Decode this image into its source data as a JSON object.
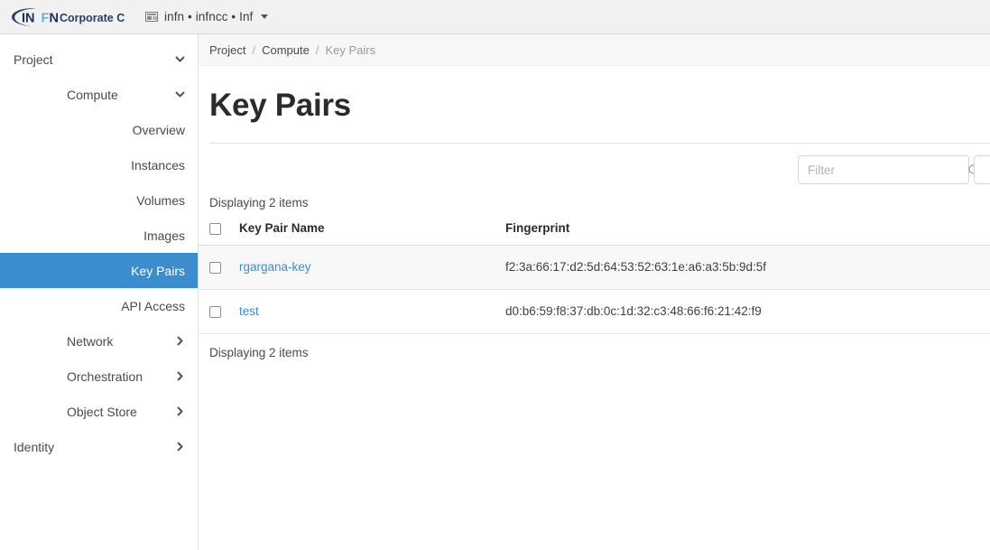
{
  "navbar": {
    "brand_text": "INFN Corporate Cloud",
    "brand_parts": {
      "in": "IN",
      "f": "F",
      "n": "N",
      "suffix": "Corporate Cloud"
    },
    "context_icon": "projects-icon",
    "context_text": "infn • infncc • Inf",
    "caret_icon": "caret-down-icon",
    "accent_color": "#3c8dcd",
    "logo_navy": "#1b2f5e",
    "logo_blue": "#5ab4d8"
  },
  "sidebar": {
    "items": [
      {
        "label": "Project",
        "level": 0,
        "icon": "chevron-down-icon",
        "active": false,
        "name": "sidebar-item-project"
      },
      {
        "label": "Compute",
        "level": 1,
        "icon": "chevron-down-icon",
        "active": false,
        "name": "sidebar-item-compute"
      },
      {
        "label": "Overview",
        "level": 2,
        "icon": "",
        "active": false,
        "name": "sidebar-item-overview"
      },
      {
        "label": "Instances",
        "level": 2,
        "icon": "",
        "active": false,
        "name": "sidebar-item-instances"
      },
      {
        "label": "Volumes",
        "level": 2,
        "icon": "",
        "active": false,
        "name": "sidebar-item-volumes"
      },
      {
        "label": "Images",
        "level": 2,
        "icon": "",
        "active": false,
        "name": "sidebar-item-images"
      },
      {
        "label": "Key Pairs",
        "level": 2,
        "icon": "",
        "active": true,
        "name": "sidebar-item-key-pairs"
      },
      {
        "label": "API Access",
        "level": 2,
        "icon": "",
        "active": false,
        "name": "sidebar-item-api-access"
      },
      {
        "label": "Network",
        "level": 1,
        "icon": "chevron-right-icon",
        "active": false,
        "name": "sidebar-item-network"
      },
      {
        "label": "Orchestration",
        "level": 1,
        "icon": "chevron-right-icon",
        "active": false,
        "name": "sidebar-item-orchestration"
      },
      {
        "label": "Object Store",
        "level": 1,
        "icon": "chevron-right-icon",
        "active": false,
        "name": "sidebar-item-object-store"
      },
      {
        "label": "Identity",
        "level": 0,
        "icon": "chevron-right-icon",
        "active": false,
        "name": "sidebar-item-identity"
      }
    ]
  },
  "main": {
    "breadcrumb": {
      "items": [
        "Project",
        "Compute",
        "Key Pairs"
      ],
      "separator": "/"
    },
    "page_title": "Key Pairs",
    "toolbar": {
      "filter_placeholder": "Filter",
      "filter_value": "",
      "search_icon": "search-icon"
    },
    "count_top": "Displaying 2 items",
    "count_bottom": "Displaying 2 items",
    "table": {
      "columns": [
        "",
        "Key Pair Name",
        "Fingerprint"
      ],
      "rows": [
        {
          "name": "rgargana-key",
          "fingerprint": "f2:3a:66:17:d2:5d:64:53:52:63:1e:a6:a3:5b:9d:5f"
        },
        {
          "name": "test",
          "fingerprint": "d0:b6:59:f8:37:db:0c:1d:32:c3:48:66:f6:21:42:f9"
        }
      ]
    }
  }
}
